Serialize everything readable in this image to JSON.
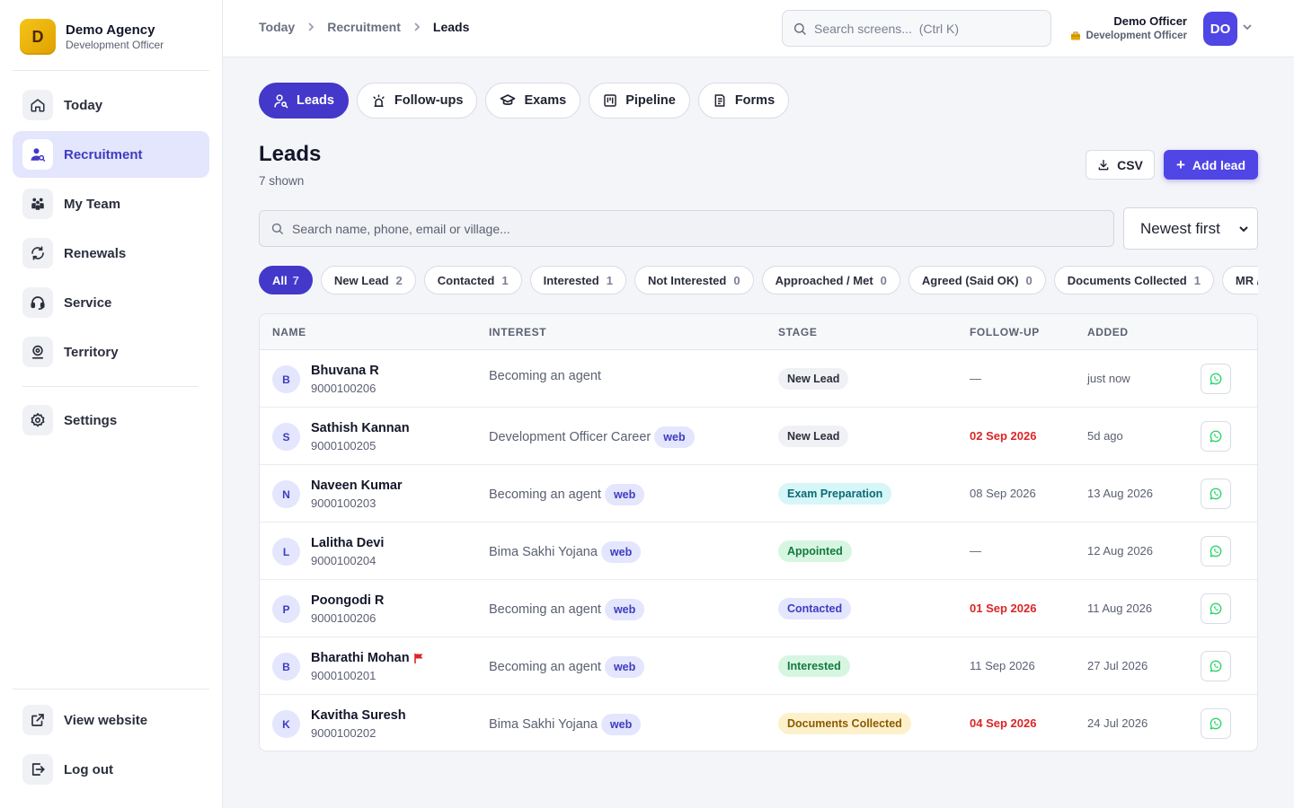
{
  "brand": {
    "logo_letter": "D",
    "name": "Demo Agency",
    "role": "Development Officer"
  },
  "sidebar": {
    "items": [
      {
        "label": "Today",
        "icon": "home-icon"
      },
      {
        "label": "Recruitment",
        "icon": "recruit-icon",
        "active": true
      },
      {
        "label": "My Team",
        "icon": "team-icon"
      },
      {
        "label": "Renewals",
        "icon": "renew-icon"
      },
      {
        "label": "Service",
        "icon": "headset-icon"
      },
      {
        "label": "Territory",
        "icon": "map-pin-icon"
      },
      {
        "label": "Settings",
        "icon": "gear-icon"
      }
    ],
    "bottom": [
      {
        "label": "View website",
        "icon": "external-link-icon"
      },
      {
        "label": "Log out",
        "icon": "logout-icon"
      }
    ]
  },
  "topbar": {
    "breadcrumb": [
      "Today",
      "Recruitment",
      "Leads"
    ],
    "search_placeholder": "Search screens...  (Ctrl K)",
    "user_name": "Demo Officer",
    "user_role": "Development Officer",
    "avatar_initials": "DO"
  },
  "tabs": [
    {
      "label": "Leads",
      "active": true
    },
    {
      "label": "Follow-ups"
    },
    {
      "label": "Exams"
    },
    {
      "label": "Pipeline"
    },
    {
      "label": "Forms"
    }
  ],
  "page": {
    "title": "Leads",
    "count_text": "7 shown",
    "csv_label": "CSV",
    "add_label": "Add lead",
    "search_placeholder": "Search name, phone, email or village...",
    "sort_value": "Newest first"
  },
  "filters": [
    {
      "label": "All",
      "count": "7",
      "active": true
    },
    {
      "label": "New Lead",
      "count": "2"
    },
    {
      "label": "Contacted",
      "count": "1"
    },
    {
      "label": "Interested",
      "count": "1"
    },
    {
      "label": "Not Interested",
      "count": "0"
    },
    {
      "label": "Approached / Met",
      "count": "0"
    },
    {
      "label": "Agreed (Said OK)",
      "count": "0"
    },
    {
      "label": "Documents Collected",
      "count": "1"
    },
    {
      "label": "MR / Appointment",
      "count": ""
    }
  ],
  "table": {
    "headers": {
      "name": "NAME",
      "interest": "INTEREST",
      "stage": "STAGE",
      "followup": "FOLLOW-UP",
      "added": "ADDED"
    },
    "rows": [
      {
        "initial": "B",
        "name": "Bhuvana R",
        "phone": "9000100206",
        "interest": "Becoming an agent",
        "source": "",
        "stage": "New Lead",
        "followup": "—",
        "added": "just now"
      },
      {
        "initial": "S",
        "name": "Sathish Kannan",
        "phone": "9000100205",
        "interest": "Development Officer Career",
        "source": "web",
        "stage": "New Lead",
        "followup": "02 Sep 2026",
        "added": "5d ago"
      },
      {
        "initial": "N",
        "name": "Naveen Kumar",
        "phone": "9000100203",
        "interest": "Becoming an agent",
        "source": "web",
        "stage": "Exam Preparation",
        "followup": "08 Sep 2026",
        "added": "13 Aug 2026"
      },
      {
        "initial": "L",
        "name": "Lalitha Devi",
        "phone": "9000100204",
        "interest": "Bima Sakhi Yojana",
        "source": "web",
        "stage": "Appointed",
        "followup": "—",
        "added": "12 Aug 2026"
      },
      {
        "initial": "P",
        "name": "Poongodi R",
        "phone": "9000100206",
        "interest": "Becoming an agent",
        "source": "web",
        "stage": "Contacted",
        "followup": "01 Sep 2026",
        "added": "11 Aug 2026"
      },
      {
        "initial": "B",
        "name": "Bharathi Mohan",
        "phone": "9000100201",
        "interest": "Becoming an agent",
        "source": "web",
        "stage": "Interested",
        "followup": "11 Sep 2026",
        "added": "27 Jul 2026"
      },
      {
        "initial": "K",
        "name": "Kavitha Suresh",
        "phone": "9000100202",
        "interest": "Bima Sakhi Yojana",
        "source": "web",
        "stage": "Documents Collected",
        "followup": "04 Sep 2026",
        "added": "24 Jul 2026"
      }
    ]
  },
  "colors": {
    "accent": "#4338ca",
    "primary_button": "#4f46e5",
    "overdue": "#dc2626",
    "whatsapp": "#25d366",
    "brand_logo": "#f5c518"
  }
}
